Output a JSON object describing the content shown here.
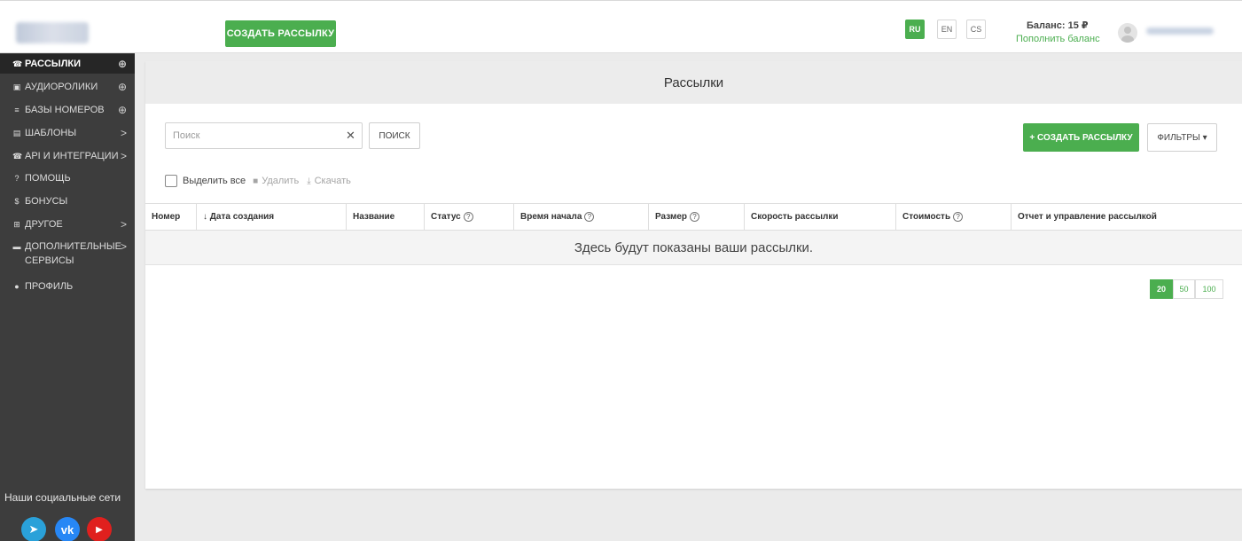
{
  "header": {
    "create_button": "СОЗДАТЬ РАССЫЛКУ",
    "languages": [
      "RU",
      "EN",
      "CS"
    ],
    "active_language": "RU",
    "balance": "Баланс: 15 ₽",
    "topup": "Пополнить баланс"
  },
  "sidebar": {
    "items": [
      {
        "icon": "phone-icon",
        "label": "РАССЫЛКИ",
        "right": "⊕"
      },
      {
        "icon": "audio-file-icon",
        "label": "АУДИОРОЛИКИ",
        "right": "⊕"
      },
      {
        "icon": "database-icon",
        "label": "БАЗЫ НОМЕРОВ",
        "right": "⊕"
      },
      {
        "icon": "templates-icon",
        "label": "ШАБЛОНЫ",
        "right": ">"
      },
      {
        "icon": "api-icon",
        "label": "API И ИНТЕГРАЦИИ",
        "right": ">"
      },
      {
        "icon": "question-icon",
        "label": "ПОМОЩЬ",
        "right": ""
      },
      {
        "icon": "dollar-icon",
        "label": "БОНУСЫ",
        "right": ""
      },
      {
        "icon": "grid-icon",
        "label": "ДРУГОЕ",
        "right": ">"
      },
      {
        "icon": "card-icon",
        "label": "ДОПОЛНИТЕЛЬНЫЕ СЕРВИСЫ",
        "right": ">"
      },
      {
        "icon": "user-icon",
        "label": "ПРОФИЛЬ",
        "right": ""
      }
    ],
    "social_title": "Наши социальные сети"
  },
  "main": {
    "title": "Рассылки",
    "search_placeholder": "Поиск",
    "search_button": "ПОИСК",
    "create_button": "+ СОЗДАТЬ РАССЫЛКУ",
    "filters_button": "ФИЛЬТРЫ ▾",
    "select_all": "Выделить все",
    "delete": "Удалить",
    "download": "Скачать",
    "columns": [
      "Номер",
      "↓ Дата создания",
      "Название",
      "Статус",
      "Время начала",
      "Размер",
      "Скорость рассылки",
      "Стоимость",
      "Отчет и управление рассылкой"
    ],
    "empty_message": "Здесь будут показаны ваши рассылки.",
    "page_sizes": [
      "20",
      "50",
      "100"
    ],
    "active_page_size": "20"
  },
  "colors": {
    "accent": "#4bae4f",
    "sidebar_bg": "#3d3d3d",
    "sidebar_active": "#262626"
  }
}
